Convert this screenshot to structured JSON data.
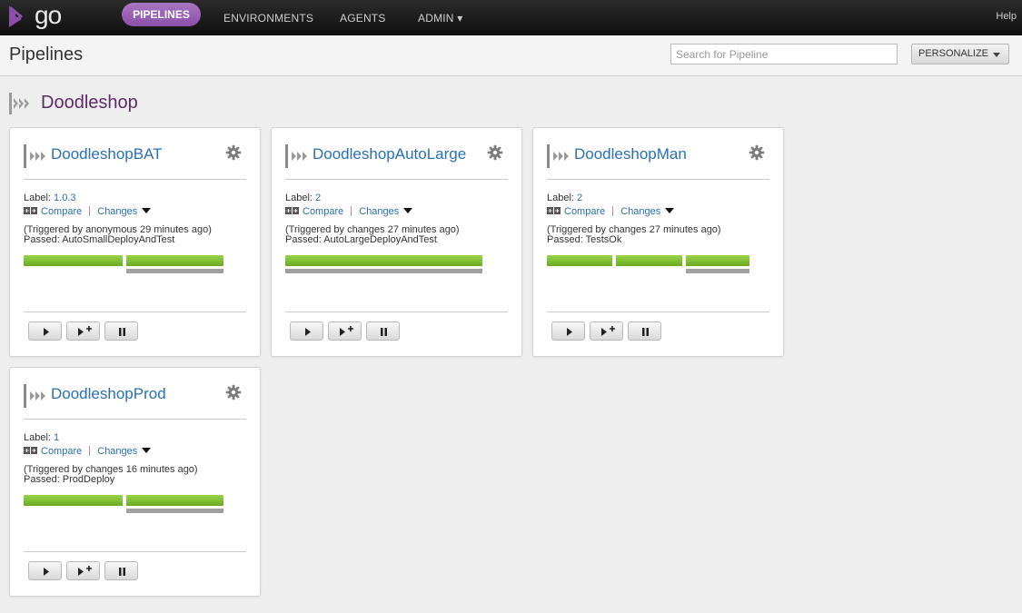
{
  "topbar": {
    "logo_text": "go",
    "nav": [
      {
        "label": "PIPELINES"
      },
      {
        "label": "ENVIRONMENTS"
      },
      {
        "label": "AGENTS"
      },
      {
        "label": "ADMIN ▾"
      }
    ],
    "help": "Help"
  },
  "header": {
    "title": "Pipelines",
    "search_placeholder": "Search for Pipeline",
    "personalize": "PERSONALIZE"
  },
  "group": {
    "title": "Doodleshop"
  },
  "colors": {
    "accent": "#8b4fa8",
    "link": "#2a6fb5",
    "passed": "#7ab82e",
    "group_title": "#5d2a66"
  },
  "pipelines": [
    {
      "name": "DoodleshopBAT",
      "label_prefix": "Label: ",
      "label": "1.0.3",
      "compare": "Compare",
      "changes": "Changes",
      "trigger": "(Triggered by anonymous 29 minutes ago)",
      "passed": "Passed: AutoSmallDeployAndTest",
      "stages": [
        {
          "status": "passed"
        },
        {
          "status": "passed"
        }
      ]
    },
    {
      "name": "DoodleshopAutoLarge",
      "label_prefix": "Label: ",
      "label": "2",
      "compare": "Compare",
      "changes": "Changes",
      "trigger": "(Triggered by changes 27 minutes ago)",
      "passed": "Passed: AutoLargeDeployAndTest",
      "stages": [
        {
          "status": "passed"
        }
      ]
    },
    {
      "name": "DoodleshopMan",
      "label_prefix": "Label: ",
      "label": "2",
      "compare": "Compare",
      "changes": "Changes",
      "trigger": "(Triggered by changes 27 minutes ago)",
      "passed": "Passed: TestsOk",
      "stages": [
        {
          "status": "passed"
        },
        {
          "status": "passed"
        },
        {
          "status": "passed"
        }
      ]
    },
    {
      "name": "DoodleshopProd",
      "label_prefix": "Label: ",
      "label": "1",
      "compare": "Compare",
      "changes": "Changes",
      "trigger": "(Triggered by changes 16 minutes ago)",
      "passed": "Passed: ProdDeploy",
      "stages": [
        {
          "status": "passed"
        },
        {
          "status": "passed"
        }
      ]
    }
  ]
}
